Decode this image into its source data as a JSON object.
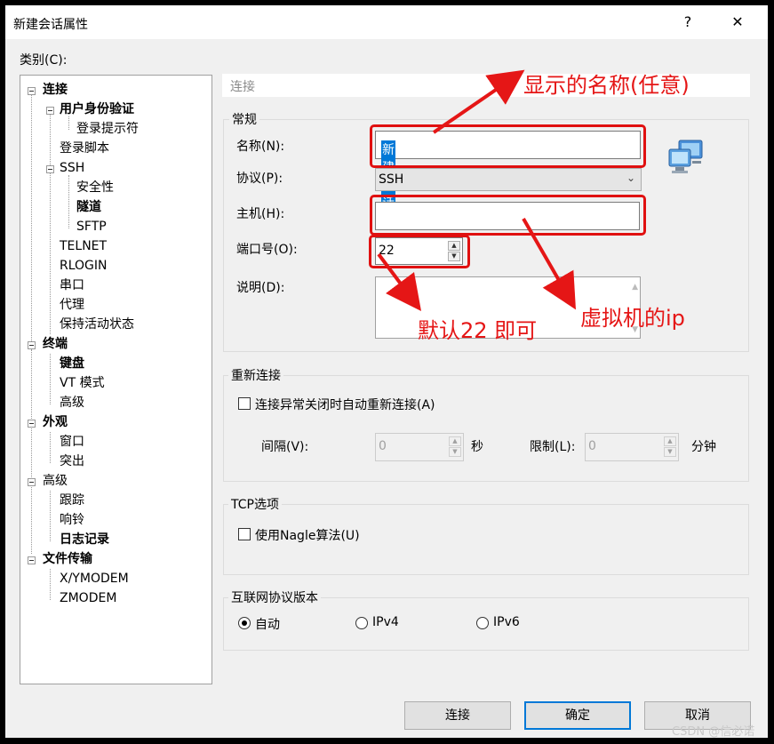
{
  "window": {
    "title": "新建会话属性",
    "help_glyph": "?",
    "close_glyph": "✕"
  },
  "category_label": "类别(C):",
  "tree": [
    {
      "label": "连接",
      "bold": true
    },
    {
      "label": "用户身份验证",
      "bold": true
    },
    {
      "label": "登录提示符",
      "bold": false
    },
    {
      "label": "登录脚本",
      "bold": false
    },
    {
      "label": "SSH",
      "bold": false
    },
    {
      "label": "安全性",
      "bold": false
    },
    {
      "label": "隧道",
      "bold": true
    },
    {
      "label": "SFTP",
      "bold": false
    },
    {
      "label": "TELNET",
      "bold": false
    },
    {
      "label": "RLOGIN",
      "bold": false
    },
    {
      "label": "串口",
      "bold": false
    },
    {
      "label": "代理",
      "bold": false
    },
    {
      "label": "保持活动状态",
      "bold": false
    },
    {
      "label": "终端",
      "bold": true
    },
    {
      "label": "键盘",
      "bold": true
    },
    {
      "label": "VT 模式",
      "bold": false
    },
    {
      "label": "高级",
      "bold": false
    },
    {
      "label": "外观",
      "bold": true
    },
    {
      "label": "窗口",
      "bold": false
    },
    {
      "label": "突出",
      "bold": false
    },
    {
      "label": "高级",
      "bold": false
    },
    {
      "label": "跟踪",
      "bold": false
    },
    {
      "label": "响铃",
      "bold": false
    },
    {
      "label": "日志记录",
      "bold": true
    },
    {
      "label": "文件传输",
      "bold": true
    },
    {
      "label": "X/YMODEM",
      "bold": false
    },
    {
      "label": "ZMODEM",
      "bold": false
    }
  ],
  "section_header": "连接",
  "general": {
    "title": "常规",
    "name_label": "名称(N):",
    "name_value": "新建会话",
    "protocol_label": "协议(P):",
    "protocol_value": "SSH",
    "host_label": "主机(H):",
    "host_value": "",
    "port_label": "端口号(O):",
    "port_value": "22",
    "desc_label": "说明(D):",
    "desc_value": ""
  },
  "reconnect": {
    "title": "重新连接",
    "checkbox_label": "连接异常关闭时自动重新连接(A)",
    "interval_label": "间隔(V):",
    "interval_value": "0",
    "interval_unit": "秒",
    "limit_label": "限制(L):",
    "limit_value": "0",
    "limit_unit": "分钟"
  },
  "tcp": {
    "title": "TCP选项",
    "nagle_label": "使用Nagle算法(U)"
  },
  "ip_version": {
    "title": "互联网协议版本",
    "options": [
      "自动",
      "IPv4",
      "IPv6"
    ],
    "selected": "自动"
  },
  "buttons": {
    "connect": "连接",
    "ok": "确定",
    "cancel": "取消"
  },
  "annotations": {
    "name_note": "显示的名称(任意)",
    "host_note": "虚拟机的ip",
    "port_note": "默认22 即可",
    "accent_color": "#e51616"
  },
  "watermark": "CSDN @信必诺"
}
